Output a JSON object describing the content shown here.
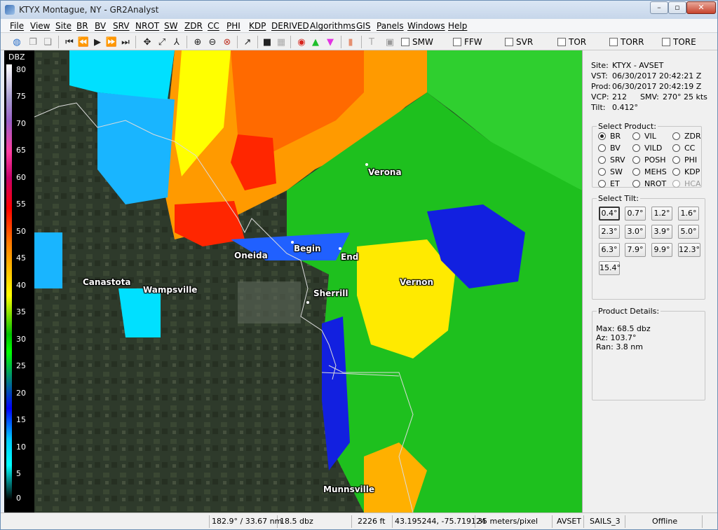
{
  "window": {
    "title": "KTYX Montague, NY - GR2Analyst"
  },
  "menu": [
    "File",
    "View",
    "Site",
    "BR",
    "BV",
    "SRV",
    "NROT",
    "SW",
    "ZDR",
    "CC",
    "PHI",
    "KDP",
    "DERIVED",
    "Algorithms",
    "GIS",
    "Panels",
    "Windows",
    "Help"
  ],
  "toolbar": {
    "checks": [
      "SMW",
      "FFW",
      "SVR",
      "TOR",
      "TORR",
      "TORE"
    ]
  },
  "legend": {
    "unit": "DBZ",
    "ticks": [
      "80",
      "75",
      "70",
      "65",
      "60",
      "55",
      "50",
      "45",
      "40",
      "35",
      "30",
      "25",
      "20",
      "15",
      "10",
      "5",
      "0"
    ]
  },
  "map": {
    "cities": [
      "Verona",
      "Oneida",
      "Begin",
      "End",
      "Canastota",
      "Wampsville",
      "Sherrill",
      "Vernon",
      "Munnsville"
    ]
  },
  "info": {
    "site_label": "Site:",
    "site_value": "KTYX - AVSET",
    "vst_label": "VST:",
    "vst_value": "06/30/2017  20:42:21 Z",
    "prod_label": "Prod:",
    "prod_value": "06/30/2017  20:42:19 Z",
    "vcp_label": "VCP:",
    "vcp_value": "212",
    "smv_label": "SMV:",
    "smv_value": "270° 25 kts",
    "tilt_label": "Tilt:",
    "tilt_value": "0.412°"
  },
  "select_product": {
    "label": "Select Product:",
    "items": [
      "BR",
      "VIL",
      "ZDR",
      "BV",
      "VILD",
      "CC",
      "SRV",
      "POSH",
      "PHI",
      "SW",
      "MEHS",
      "KDP",
      "ET",
      "NROT",
      "HCA"
    ],
    "selected": "BR"
  },
  "select_tilt": {
    "label": "Select Tilt:",
    "items": [
      "0.4°",
      "0.7°",
      "1.2°",
      "1.6°",
      "2.3°",
      "3.0°",
      "3.9°",
      "5.0°",
      "6.3°",
      "7.9°",
      "9.9°",
      "12.3°",
      "15.4°"
    ],
    "selected": "0.4°"
  },
  "details": {
    "label": "Product Details:",
    "max": "Max:  68.5 dbz",
    "az": "Az:  103.7°",
    "ran": "Ran:  3.8 nm"
  },
  "status": [
    "182.9° / 33.67 nm",
    "18.5 dbz",
    "2226 ft",
    "43.195244, -75.719124",
    "35 meters/pixel",
    "AVSET",
    "SAILS_3",
    "Offline"
  ]
}
